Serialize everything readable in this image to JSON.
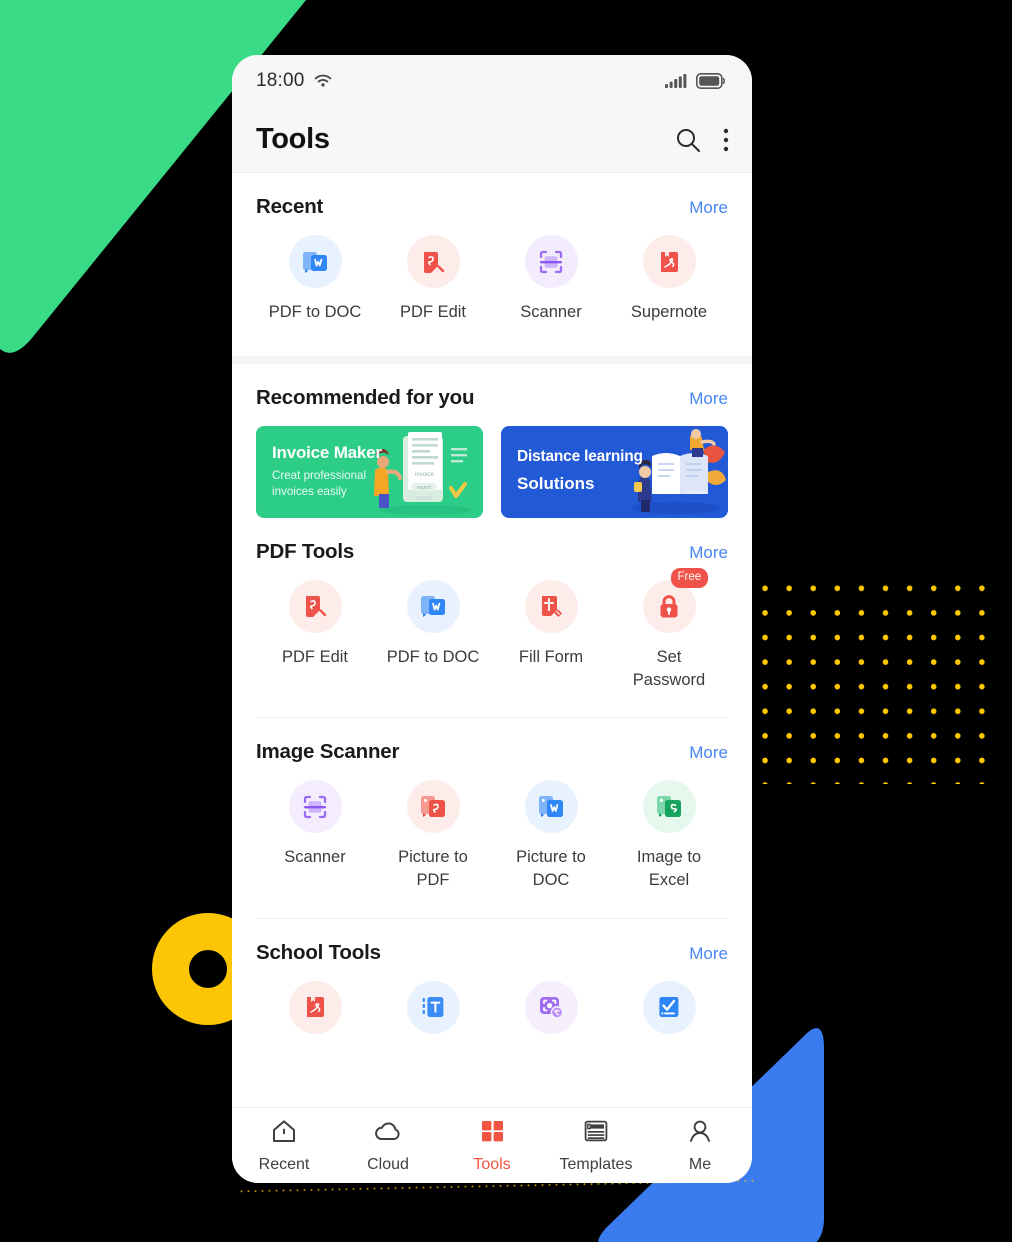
{
  "decor": {
    "green_shape": "green-rounded-triangle",
    "yellow_ring": "yellow-ring",
    "blue_shape": "blue-rounded-triangle",
    "dot_grid": "yellow-dot-grid",
    "colors": {
      "green": "#2BCD87",
      "yellow": "#FCC605",
      "dot_yellow": "#FFC700",
      "blue": "#3B7BF0"
    }
  },
  "status_bar": {
    "time": "18:00",
    "wifi_icon": "wifi-icon",
    "signal_icon": "cellular-signal-icon",
    "battery_icon": "battery-icon"
  },
  "app_bar": {
    "title": "Tools",
    "search_icon": "search-icon",
    "overflow_icon": "more-vertical-icon"
  },
  "sections": [
    {
      "id": "recent",
      "title": "Recent",
      "more_label": "More",
      "tiles": [
        {
          "label": "PDF to DOC",
          "icon": "pdf-to-doc-icon",
          "bg": "#E8F1FE",
          "fg": "#2F86F6"
        },
        {
          "label": "PDF Edit",
          "icon": "pdf-edit-icon",
          "bg": "#FDECEA",
          "fg": "#EE5248"
        },
        {
          "label": "Scanner",
          "icon": "scanner-icon",
          "bg": "#F2ECFD",
          "fg": "#9B6CF3"
        },
        {
          "label": "Supernote",
          "icon": "supernote-icon",
          "bg": "#FDECEA",
          "fg": "#EE5248"
        }
      ]
    },
    {
      "id": "recommended",
      "title": "Recommended for you",
      "more_label": "More",
      "banners": [
        {
          "theme": "green",
          "title": "Invoice Maker",
          "subtitle": "Creat professional\ninvoices easily",
          "art": "invoice-illustration",
          "bg": "#2BCD87"
        },
        {
          "theme": "blue",
          "title": "Distance learning",
          "subtitle": "Solutions",
          "art": "distance-learning-illustration",
          "bg": "#2159D6"
        }
      ]
    },
    {
      "id": "pdf-tools",
      "title": "PDF Tools",
      "more_label": "More",
      "tiles": [
        {
          "label": "PDF Edit",
          "icon": "pdf-edit-icon",
          "bg": "#FDECEA",
          "fg": "#EE5248"
        },
        {
          "label": "PDF to DOC",
          "icon": "pdf-to-doc-icon",
          "bg": "#E8F1FE",
          "fg": "#2F86F6"
        },
        {
          "label": "Fill Form",
          "icon": "fill-form-icon",
          "bg": "#FDECEA",
          "fg": "#EE5248"
        },
        {
          "label": "Set Password",
          "icon": "lock-icon",
          "bg": "#FDECEA",
          "fg": "#EE5248",
          "badge": "Free"
        }
      ]
    },
    {
      "id": "image-scanner",
      "title": "Image Scanner",
      "more_label": "More",
      "tiles": [
        {
          "label": "Scanner",
          "icon": "scanner-icon",
          "bg": "#F3EDFD",
          "fg": "#9B6CF3"
        },
        {
          "label": "Picture to PDF",
          "icon": "picture-to-pdf-icon",
          "bg": "#FDECEA",
          "fg": "#EE5248"
        },
        {
          "label": "Picture to\nDOC",
          "icon": "picture-to-doc-icon",
          "bg": "#E8F1FE",
          "fg": "#2F86F6"
        },
        {
          "label": "Image to\nExcel",
          "icon": "image-to-excel-icon",
          "bg": "#E6F7EE",
          "fg": "#16A45F"
        }
      ]
    },
    {
      "id": "school-tools",
      "title": "School Tools",
      "more_label": "More",
      "tiles": [
        {
          "label": "",
          "icon": "supernote-icon",
          "bg": "#FDECEA",
          "fg": "#EE5248"
        },
        {
          "label": "",
          "icon": "text-note-icon",
          "bg": "#E8F1FE",
          "fg": "#3B8CF6"
        },
        {
          "label": "",
          "icon": "photo-translate-icon",
          "bg": "#F5EEFD",
          "fg": "#A06CF0"
        },
        {
          "label": "",
          "icon": "checklist-icon",
          "bg": "#E8F1FE",
          "fg": "#2F86F6"
        }
      ]
    }
  ],
  "bottom_nav": {
    "items": [
      {
        "label": "Recent",
        "icon": "home-icon",
        "active": false
      },
      {
        "label": "Cloud",
        "icon": "cloud-icon",
        "active": false
      },
      {
        "label": "Tools",
        "icon": "grid-icon",
        "active": true
      },
      {
        "label": "Templates",
        "icon": "templates-icon",
        "active": false
      },
      {
        "label": "Me",
        "icon": "person-icon",
        "active": false
      }
    ],
    "active_color": "#F05542"
  }
}
